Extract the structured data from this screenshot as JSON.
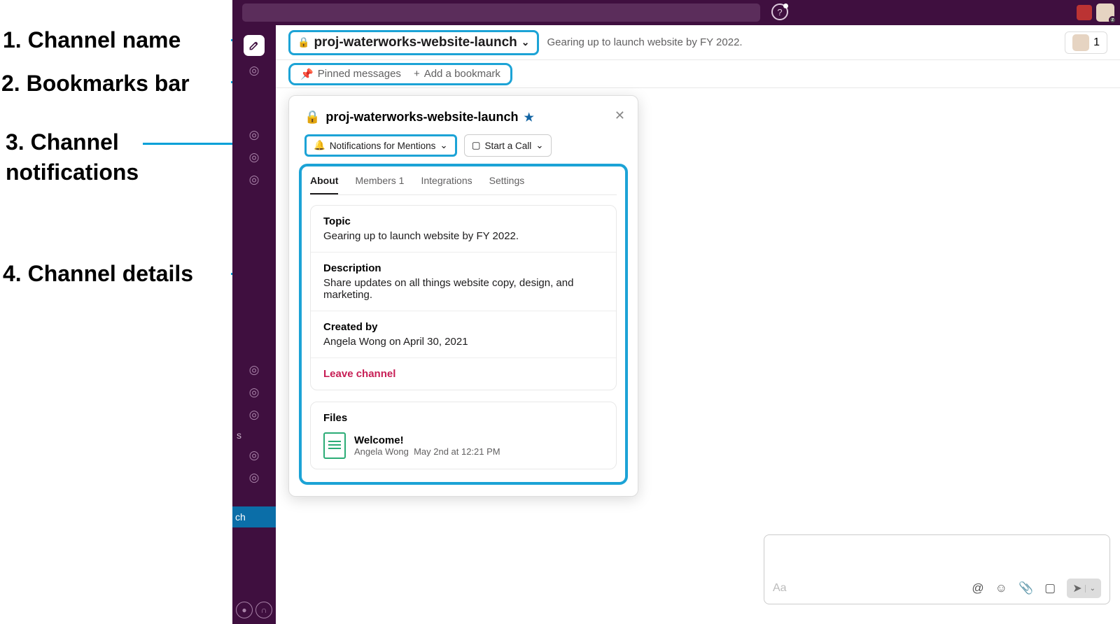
{
  "annotations": {
    "a1": "1. Channel name",
    "a2": "2. Bookmarks bar",
    "a3": "3. Channel\nnotifications",
    "a4": "4. Channel details"
  },
  "channel": {
    "name": "proj-waterworks-website-launch",
    "topic": "Gearing up to launch website by FY 2022.",
    "member_count": "1"
  },
  "bookmarks": {
    "pinned": "Pinned messages",
    "add": "Add a bookmark"
  },
  "popover": {
    "title": "proj-waterworks-website-launch",
    "notifications_btn": "Notifications for Mentions",
    "call_btn": "Start a Call",
    "tabs": {
      "about": "About",
      "members": "Members 1",
      "integrations": "Integrations",
      "settings": "Settings"
    },
    "topic_label": "Topic",
    "topic_value": "Gearing up to launch website by FY 2022.",
    "description_label": "Description",
    "description_value": "Share updates on all things website copy, design, and marketing.",
    "created_label": "Created by",
    "created_value": "Angela Wong on April 30, 2021",
    "leave": "Leave channel",
    "files_label": "Files",
    "file": {
      "name": "Welcome!",
      "author": "Angela Wong",
      "time": "May 2nd at 12:21 PM"
    }
  },
  "sidebar": {
    "active_label": "ch",
    "section_label": "s"
  }
}
